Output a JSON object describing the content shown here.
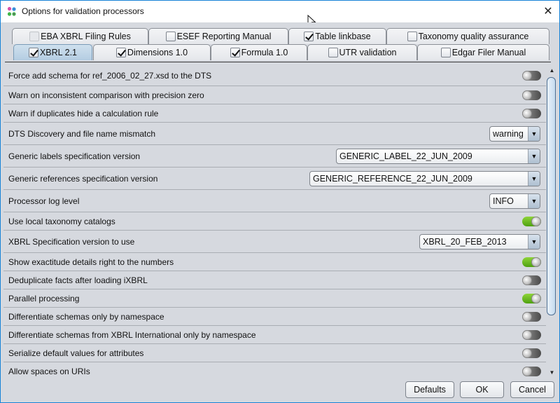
{
  "window": {
    "title": "Options for validation processors",
    "app_icon": "app-molecule-icon",
    "close_icon": "close-icon",
    "close_glyph": "✕"
  },
  "tabs": {
    "top_row": [
      {
        "label": "EBA XBRL Filing Rules",
        "checked": false,
        "disabled": true
      },
      {
        "label": "ESEF Reporting Manual",
        "checked": false,
        "disabled": false
      },
      {
        "label": "Table linkbase",
        "checked": true,
        "disabled": false
      },
      {
        "label": "Taxonomy quality assurance",
        "checked": false,
        "disabled": false
      }
    ],
    "bottom_row": [
      {
        "label": "XBRL 2.1",
        "checked": true,
        "selected": true
      },
      {
        "label": "Dimensions 1.0",
        "checked": true,
        "selected": false
      },
      {
        "label": "Formula 1.0",
        "checked": true,
        "selected": false
      },
      {
        "label": "UTR validation",
        "checked": false,
        "selected": false
      },
      {
        "label": "Edgar Filer Manual",
        "checked": false,
        "selected": false
      }
    ]
  },
  "options": [
    {
      "label": "Force add schema for ref_2006_02_27.xsd to the DTS",
      "type": "toggle",
      "on": false
    },
    {
      "label": "Warn on inconsistent comparison with precision zero",
      "type": "toggle",
      "on": false
    },
    {
      "label": "Warn if duplicates hide a calculation rule",
      "type": "toggle",
      "on": false
    },
    {
      "label": "DTS Discovery and file name mismatch",
      "type": "select",
      "value": "warning"
    },
    {
      "label": "Generic labels specification version",
      "type": "select",
      "value": "GENERIC_LABEL_22_JUN_2009"
    },
    {
      "label": "Generic references specification version",
      "type": "select",
      "value": "GENERIC_REFERENCE_22_JUN_2009"
    },
    {
      "label": "Processor log level",
      "type": "select",
      "value": "INFO"
    },
    {
      "label": "Use local taxonomy catalogs",
      "type": "toggle",
      "on": true
    },
    {
      "label": "XBRL Specification version to use",
      "type": "select",
      "value": "XBRL_20_FEB_2013"
    },
    {
      "label": "Show exactitude details right to the numbers",
      "type": "toggle",
      "on": true
    },
    {
      "label": "Deduplicate facts after loading iXBRL",
      "type": "toggle",
      "on": false
    },
    {
      "label": "Parallel processing",
      "type": "toggle",
      "on": true
    },
    {
      "label": "Differentiate schemas only by namespace",
      "type": "toggle",
      "on": false
    },
    {
      "label": "Differentiate schemas from XBRL International only by namespace",
      "type": "toggle",
      "on": false
    },
    {
      "label": "Serialize default values for attributes",
      "type": "toggle",
      "on": false
    },
    {
      "label": "Allow spaces on URIs",
      "type": "toggle",
      "on": false
    }
  ],
  "scrollbar": {
    "up_glyph": "▲",
    "down_glyph": "▼"
  },
  "select_arrow_glyph": "▼",
  "buttons": {
    "defaults": "Defaults",
    "ok": "OK",
    "cancel": "Cancel"
  }
}
